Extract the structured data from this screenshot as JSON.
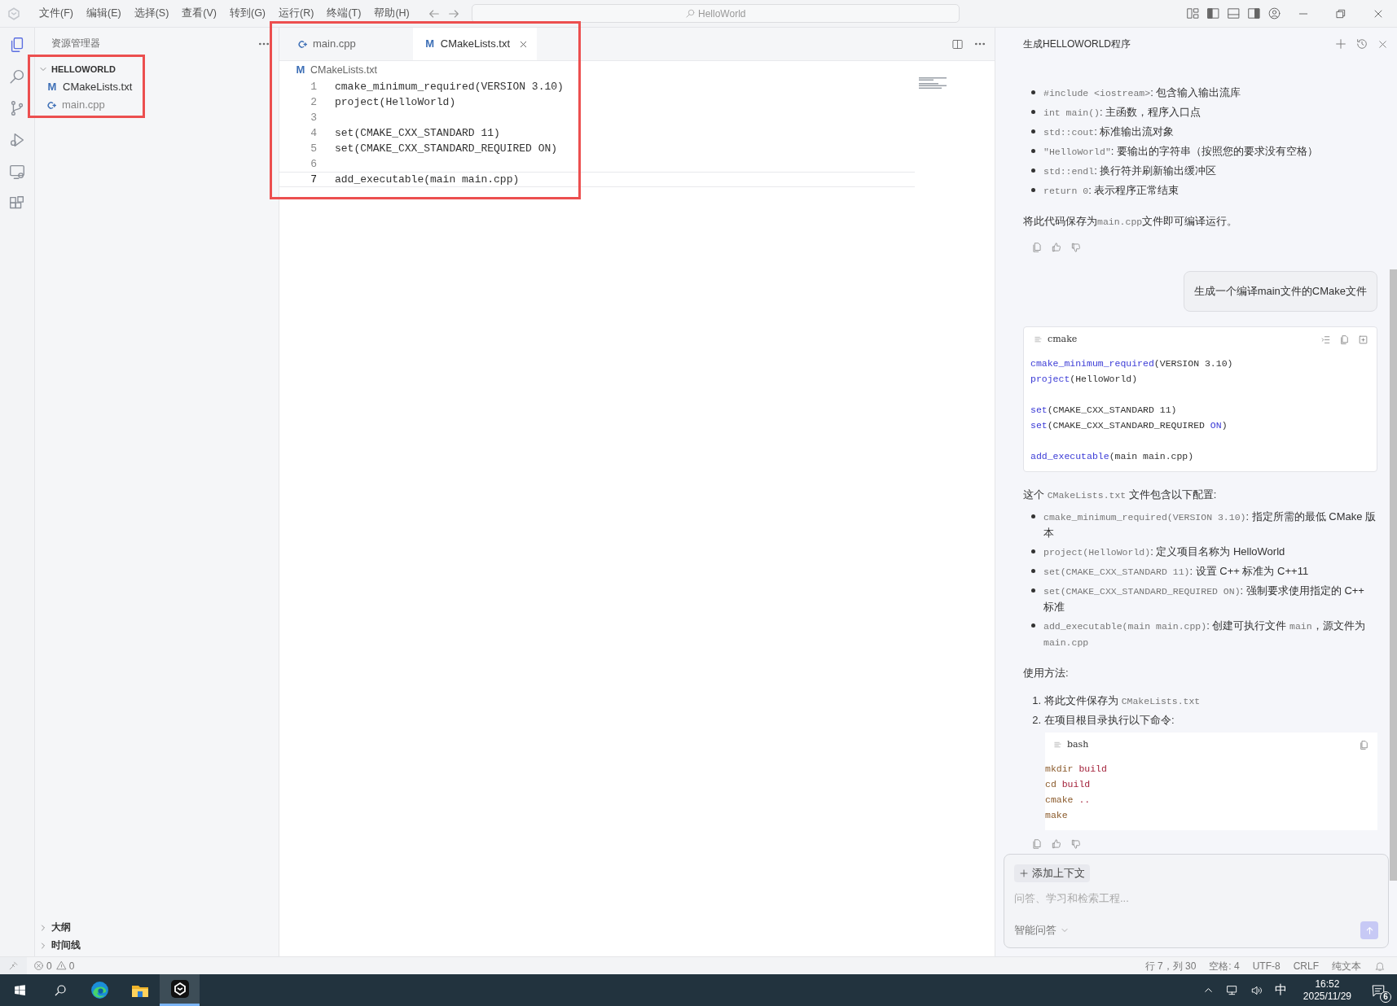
{
  "title_bar": {
    "menus": [
      "文件(F)",
      "编辑(E)",
      "选择(S)",
      "查看(V)",
      "转到(G)",
      "运行(R)",
      "终端(T)",
      "帮助(H)"
    ],
    "search": "HelloWorld"
  },
  "activity_bar": [
    {
      "kind": "files",
      "selected": true
    },
    {
      "kind": "search",
      "selected": false
    },
    {
      "kind": "branch",
      "selected": false
    },
    {
      "kind": "debug",
      "selected": false
    },
    {
      "kind": "remote",
      "selected": false
    },
    {
      "kind": "extensions",
      "selected": false
    }
  ],
  "sidebar": {
    "title": "资源管理器",
    "folder": {
      "name": "HELLOWORLD",
      "expanded": true,
      "children": [
        {
          "name": "CMakeLists.txt",
          "kind": "cmake",
          "icon_text": "M",
          "selected": true
        },
        {
          "name": "main.cpp",
          "kind": "cpp",
          "selected": false
        }
      ]
    },
    "sections": [
      {
        "label": "大纲",
        "expanded": false
      },
      {
        "label": "时间线",
        "expanded": false
      }
    ]
  },
  "editor": {
    "tabs": [
      {
        "label": "main.cpp",
        "kind": "cpp",
        "selected": false
      },
      {
        "label": "CMakeLists.txt",
        "kind": "cmake",
        "icon_text": "M",
        "selected": true
      }
    ],
    "breadcrumb": {
      "kind": "cmake",
      "icon_text": "M",
      "label": "CMakeLists.txt"
    },
    "lines": [
      {
        "number": "1",
        "text": "cmake_minimum_required(VERSION 3.10)",
        "current": false
      },
      {
        "number": "2",
        "text": "project(HelloWorld)",
        "current": false
      },
      {
        "number": "3",
        "current": false
      },
      {
        "number": "4",
        "text": "set(CMAKE_CXX_STANDARD 11)",
        "current": false
      },
      {
        "number": "5",
        "text": "set(CMAKE_CXX_STANDARD_REQUIRED ON)",
        "current": false
      },
      {
        "number": "6",
        "current": false
      },
      {
        "number": "7",
        "text": "add_executable(main main.cpp)",
        "current": true
      }
    ]
  },
  "chat": {
    "title": "生成HELLOWORLD程序",
    "blocks": [
      {
        "kind": "bullets",
        "items": [
          [
            {
              "text": "#include <iostream>",
              "code": true
            },
            {
              "text": ": 包含输入输出流库"
            }
          ],
          [
            {
              "text": "int main()",
              "code": true
            },
            {
              "text": ": 主函数，程序入口点"
            }
          ],
          [
            {
              "text": "std::cout",
              "code": true
            },
            {
              "text": ": 标准输出流对象"
            }
          ],
          [
            {
              "text": "\"HelloWorld\"",
              "code": true
            },
            {
              "text": ": 要输出的字符串（按照您的要求没有空格）"
            }
          ],
          [
            {
              "text": "std::endl",
              "code": true
            },
            {
              "text": ": 换行符并刷新输出缓冲区"
            }
          ],
          [
            {
              "text": "return 0",
              "code": true
            },
            {
              "text": ": 表示程序正常结束"
            }
          ]
        ]
      },
      {
        "kind": "paragraph",
        "segments": [
          {
            "text": "将此代码保存为"
          },
          {
            "text": "main.cpp",
            "code": true
          },
          {
            "text": "文件即可编译运行。"
          }
        ]
      },
      {
        "kind": "feedback"
      },
      {
        "kind": "user",
        "text": "生成一个编译main文件的CMake文件"
      },
      {
        "kind": "code",
        "lang": "cmake",
        "bordered": true,
        "lines": [
          {
            "kind": "code",
            "tokens": [
              {
                "text": "cmake_minimum_required",
                "kind": "keyword"
              },
              {
                "text": "(VERSION 3.10)",
                "kind": "plain"
              }
            ]
          },
          {
            "kind": "code",
            "tokens": [
              {
                "text": "project",
                "kind": "keyword"
              },
              {
                "text": "(HelloWorld)",
                "kind": "plain"
              }
            ]
          },
          {
            "kind": "blank"
          },
          {
            "kind": "code",
            "tokens": [
              {
                "text": "set",
                "kind": "keyword"
              },
              {
                "text": "(CMAKE_CXX_STANDARD 11)",
                "kind": "plain"
              }
            ]
          },
          {
            "kind": "code",
            "tokens": [
              {
                "text": "set",
                "kind": "keyword"
              },
              {
                "text": "(CMAKE_CXX_STANDARD_REQUIRED ",
                "kind": "plain"
              },
              {
                "text": "ON",
                "kind": "keyword"
              },
              {
                "text": ")",
                "kind": "plain"
              }
            ]
          },
          {
            "kind": "blank"
          },
          {
            "kind": "code",
            "tokens": [
              {
                "text": "add_executable",
                "kind": "keyword"
              },
              {
                "text": "(main main.cpp)",
                "kind": "plain"
              }
            ]
          }
        ]
      },
      {
        "kind": "paragraph",
        "segments": [
          {
            "text": "这个 "
          },
          {
            "text": "CMakeLists.txt",
            "code": true
          },
          {
            "text": " 文件包含以下配置:"
          }
        ]
      },
      {
        "kind": "bullets",
        "items": [
          [
            {
              "text": "cmake_minimum_required(VERSION 3.10)",
              "code": true
            },
            {
              "text": ": 指定所需的最低 CMake 版本"
            }
          ],
          [
            {
              "text": "project(HelloWorld)",
              "code": true
            },
            {
              "text": ": 定义项目名称为 HelloWorld"
            }
          ],
          [
            {
              "text": "set(CMAKE_CXX_STANDARD 11)",
              "code": true
            },
            {
              "text": ": 设置 C++ 标准为 C++11"
            }
          ],
          [
            {
              "text": "set(CMAKE_CXX_STANDARD_REQUIRED ON)",
              "code": true
            },
            {
              "text": ": 强制要求使用指定的 C++ 标准"
            }
          ],
          [
            {
              "text": "add_executable(main main.cpp)",
              "code": true
            },
            {
              "text": ": 创建可执行文件 "
            },
            {
              "text": "main",
              "code": true
            },
            {
              "text": "，源文件为 "
            },
            {
              "text": "main.cpp",
              "code": true
            }
          ]
        ]
      },
      {
        "kind": "paragraph",
        "segments": [
          {
            "text": "使用方法:"
          }
        ]
      },
      {
        "kind": "ordered",
        "items": [
          {
            "number": "1.",
            "segments": [
              {
                "text": "将此文件保存为 "
              },
              {
                "text": "CMakeLists.txt",
                "code": true
              }
            ]
          },
          {
            "number": "2.",
            "segments": [
              {
                "text": "在项目根目录执行以下命令:"
              }
            ],
            "code": {
              "lang": "bash",
              "bordered": false,
              "lines": [
                {
                  "kind": "code",
                  "tokens": [
                    {
                      "text": "mkdir",
                      "kind": "command"
                    },
                    {
                      "text": " build",
                      "kind": "arg"
                    }
                  ]
                },
                {
                  "kind": "code",
                  "tokens": [
                    {
                      "text": "cd",
                      "kind": "command"
                    },
                    {
                      "text": " build",
                      "kind": "arg"
                    }
                  ]
                },
                {
                  "kind": "code",
                  "tokens": [
                    {
                      "text": "cmake",
                      "kind": "command"
                    },
                    {
                      "text": " ..",
                      "kind": "arg"
                    }
                  ]
                },
                {
                  "kind": "code",
                  "tokens": [
                    {
                      "text": "make",
                      "kind": "command"
                    }
                  ]
                }
              ]
            }
          }
        ]
      },
      {
        "kind": "feedback"
      }
    ],
    "input": {
      "context_chip": "添加上下文",
      "placeholder": "问答、学习和检索工程...",
      "mode": "智能问答",
      "send_disabled": true
    }
  },
  "status_bar": {
    "errors": "0",
    "warnings": "0",
    "items": [
      "行 7，列 30",
      "空格: 4",
      "UTF-8",
      "CRLF",
      "纯文本"
    ]
  },
  "taskbar": {
    "apps": [
      {
        "kind": "start",
        "selected": false
      },
      {
        "kind": "search",
        "selected": false
      },
      {
        "kind": "edge",
        "selected": false
      },
      {
        "kind": "explorer",
        "selected": false
      },
      {
        "kind": "app",
        "selected": true
      }
    ],
    "ime": "中",
    "time": "16:52",
    "date": "2025/11/29",
    "notifications": "6"
  }
}
